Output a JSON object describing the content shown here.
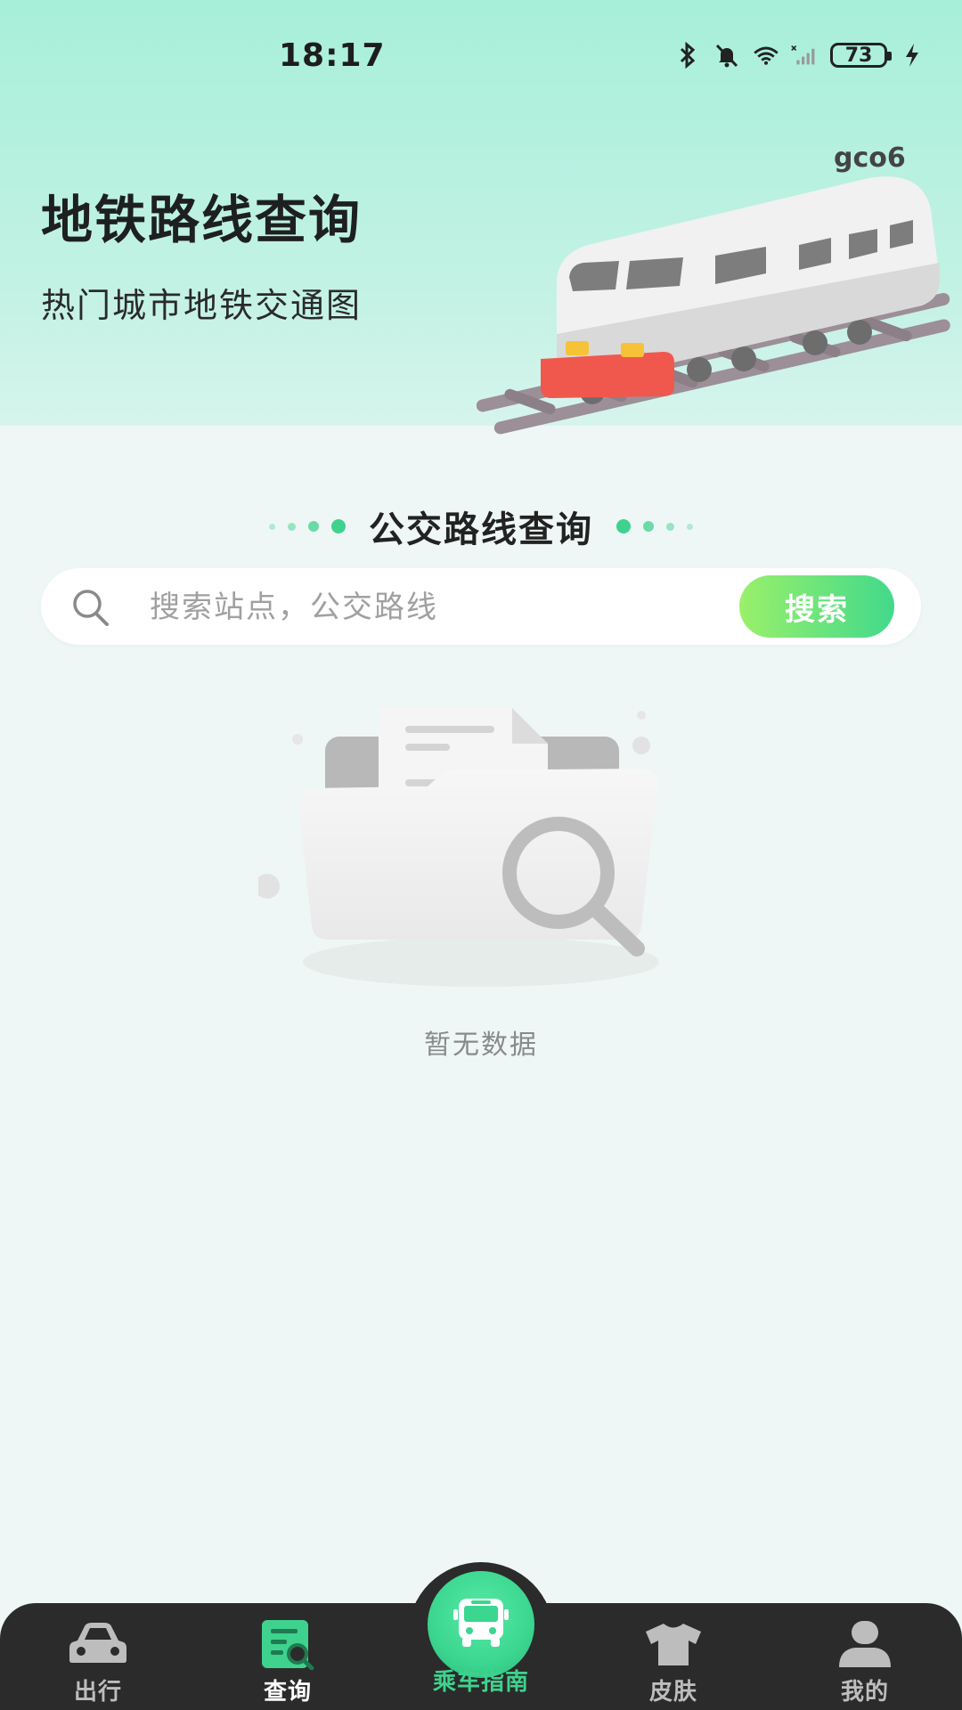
{
  "status_bar": {
    "time": "18:17",
    "battery": "73"
  },
  "hero": {
    "title": "地铁路线查询",
    "subtitle": "热门城市地铁交通图",
    "watermark": "gco6"
  },
  "section": {
    "title": "公交路线查询"
  },
  "search": {
    "placeholder": "搜索站点，公交路线",
    "value": "",
    "button_label": "搜索"
  },
  "empty_state": {
    "text": "暂无数据"
  },
  "tabs": [
    {
      "label": "出行",
      "icon": "car-icon",
      "active": false
    },
    {
      "label": "查询",
      "icon": "search-document-icon",
      "active": true
    },
    {
      "label": "乘车指南",
      "icon": "bus-icon",
      "active": false
    },
    {
      "label": "皮肤",
      "icon": "tshirt-icon",
      "active": false
    },
    {
      "label": "我的",
      "icon": "user-icon",
      "active": false
    }
  ],
  "colors": {
    "accent": "#3ed28e",
    "tabbar": "#2b2b2b",
    "header": "#a7efd9"
  }
}
